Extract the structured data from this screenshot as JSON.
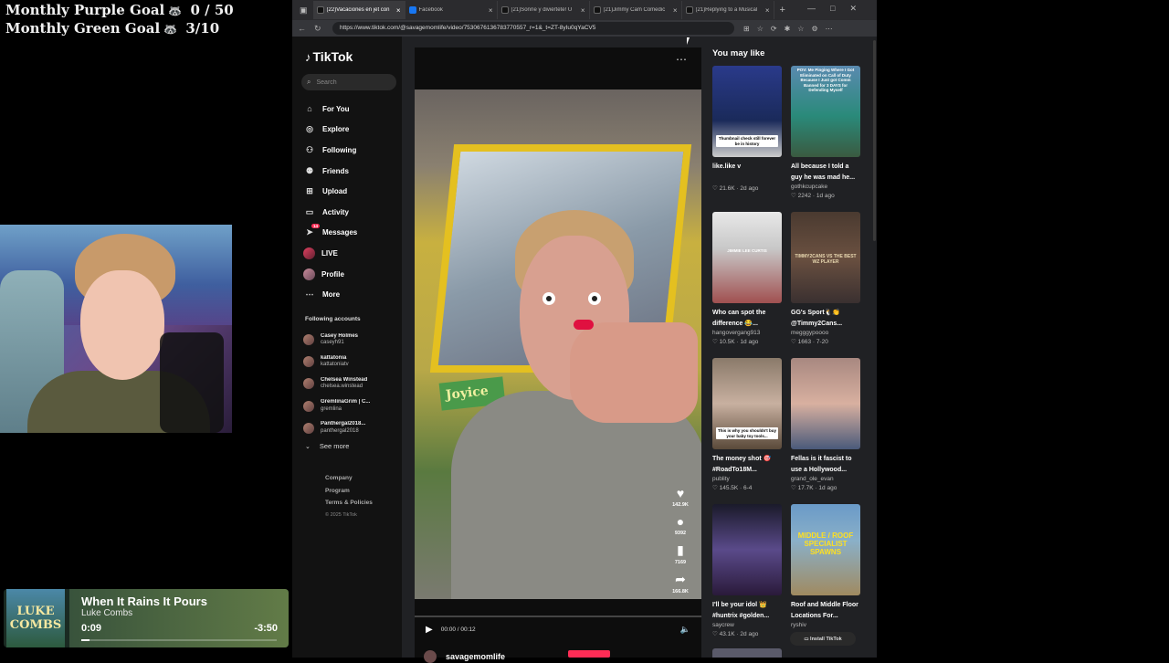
{
  "overlay": {
    "purple_goal": "Monthly Purple Goal",
    "purple_value": "0 / 50",
    "green_goal": "Monthly Green Goal",
    "green_value": "3/10"
  },
  "now_playing": {
    "song": "When It Rains It Pours",
    "artist": "Luke Combs",
    "elapsed": "0:09",
    "remaining": "-3:50",
    "progress": 0.04,
    "cover_text": "LUKE COMBS"
  },
  "browser": {
    "tabs": [
      {
        "title": "(22)Vacaciones en jet con",
        "icon": "tiktok-icon",
        "active": true
      },
      {
        "title": "Facebook",
        "icon": "facebook-icon",
        "active": false
      },
      {
        "title": "(21)Sonríe y diviértete! U",
        "icon": "tiktok-icon",
        "active": false
      },
      {
        "title": "(21)Jimmy Cam Comedic",
        "icon": "tiktok-icon",
        "active": false
      },
      {
        "title": "(21)Replying to a Musical",
        "icon": "tiktok-icon",
        "active": false
      }
    ],
    "url": "https://www.tiktok.com/@savagemomlife/video/7530676136783770557_r=1&_t=ZT-8yIu0qYaCV5"
  },
  "tiktok": {
    "logo": "TikTok",
    "search_placeholder": "Search",
    "nav": [
      {
        "label": "For You",
        "icon": "home-icon"
      },
      {
        "label": "Explore",
        "icon": "compass-icon"
      },
      {
        "label": "Following",
        "icon": "following-icon"
      },
      {
        "label": "Friends",
        "icon": "friends-icon"
      },
      {
        "label": "Upload",
        "icon": "upload-icon"
      },
      {
        "label": "Activity",
        "icon": "activity-icon"
      },
      {
        "label": "Messages",
        "icon": "messages-icon",
        "badge": "14"
      },
      {
        "label": "LIVE",
        "icon": "live-icon"
      },
      {
        "label": "Profile",
        "icon": "profile-avatar"
      },
      {
        "label": "More",
        "icon": "more-icon"
      }
    ],
    "following_title": "Following accounts",
    "following": [
      {
        "name": "Casey Holmes",
        "handle": "caseyh91"
      },
      {
        "name": "kattatonia",
        "handle": "kattatoniatv"
      },
      {
        "name": "Chelsea Winstead",
        "handle": "chelsea.winstead"
      },
      {
        "name": "GremlinaGrim | C...",
        "handle": "gremlina"
      },
      {
        "name": "Panthergal2018...",
        "handle": "panthergal2018"
      }
    ],
    "see_more": "See more",
    "footer": {
      "company": "Company",
      "program": "Program",
      "terms": "Terms & Policies",
      "copyright": "© 2025 TikTok"
    },
    "video": {
      "likes": "142.9K",
      "comments": "9392",
      "saves": "7169",
      "shares": "166.8K",
      "time": "00:00 / 00:12",
      "author": "savagemomlife",
      "sticker": "Joyice"
    },
    "you_may_like_title": "You may like",
    "cards": [
      {
        "title": "like.like v",
        "author": "",
        "likes": "21.6K",
        "age": "2d ago",
        "cap": "Thumbnail check still forever be in history"
      },
      {
        "title": "All because I told a guy he was mad he...",
        "author": "gothkcupcake",
        "likes": "2242",
        "age": "1d ago",
        "cap": "POV: Me Pinging Where I Got Eliminated on Call of Duty Because I Just got Comm Banned for 3 DAYS for Defending Myself"
      },
      {
        "title": "Who can spot the difference 😂...",
        "author": "hangovergang913",
        "likes": "10.5K",
        "age": "1d ago",
        "cap": "JIMMIE LEE CURTIS"
      },
      {
        "title": "GG's Sport🐧👏 @Timmy2Cans...",
        "author": "megggypoooo",
        "likes": "1663",
        "age": "7-20",
        "cap": "TIMMY2CANS VS THE BEST WZ PLAYER"
      },
      {
        "title": "The money shot 🎯 #RoadTo18M...",
        "author": "publity",
        "likes": "145.5K",
        "age": "6-4",
        "cap": "This is why you shouldn't buy your baby toy tools..."
      },
      {
        "title": "Fellas is it fascist to use a Hollywood...",
        "author": "grand_ole_evan",
        "likes": "17.7K",
        "age": "1d ago",
        "cap": ""
      },
      {
        "title": "I'll be your idol 👑 #huntrix #golden...",
        "author": "saycrew",
        "likes": "43.1K",
        "age": "2d ago",
        "cap": ""
      },
      {
        "title": "Roof and Middle Floor Locations For...",
        "author": "ryshiv",
        "likes": "",
        "age": "",
        "cap": "MIDDLE / ROOF SPECIALIST SPAWNS"
      }
    ],
    "install_label": "Install TikTok"
  }
}
